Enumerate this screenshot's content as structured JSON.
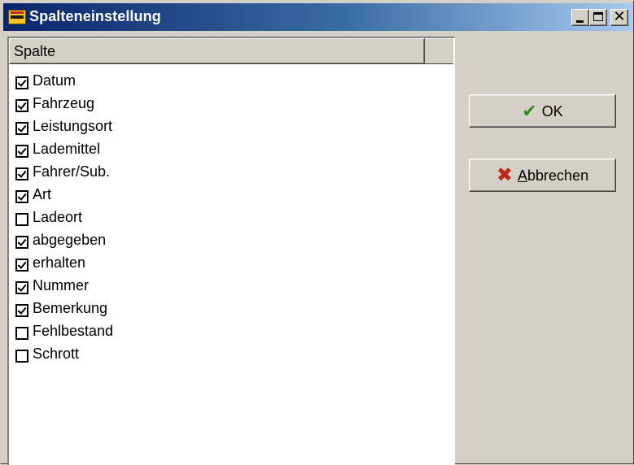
{
  "window": {
    "title": "Spalteneinstellung"
  },
  "list": {
    "column_header": "Spalte",
    "items": [
      {
        "label": "Datum",
        "checked": true
      },
      {
        "label": "Fahrzeug",
        "checked": true
      },
      {
        "label": "Leistungsort",
        "checked": true
      },
      {
        "label": "Lademittel",
        "checked": true
      },
      {
        "label": "Fahrer/Sub.",
        "checked": true
      },
      {
        "label": "Art",
        "checked": true
      },
      {
        "label": "Ladeort",
        "checked": false
      },
      {
        "label": "abgegeben",
        "checked": true
      },
      {
        "label": "erhalten",
        "checked": true
      },
      {
        "label": "Nummer",
        "checked": true
      },
      {
        "label": "Bemerkung",
        "checked": true
      },
      {
        "label": "Fehlbestand",
        "checked": false
      },
      {
        "label": "Schrott",
        "checked": false
      }
    ]
  },
  "buttons": {
    "ok_label": "OK",
    "cancel_label": "Abbrechen",
    "ok_icon": "checkmark-icon",
    "cancel_icon": "cross-icon"
  },
  "colors": {
    "ok_icon": "#2f8f1f",
    "cancel_icon": "#c0261c",
    "title_bar": "#0a246a"
  }
}
